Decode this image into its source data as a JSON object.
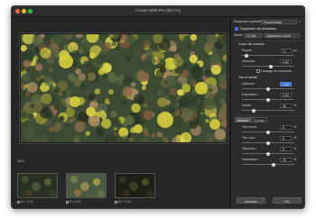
{
  "window": {
    "title": "Fusion HDR Pro (90,7%)"
  },
  "preview": {
    "zoom": "55%"
  },
  "thumbs": [
    {
      "label": "EV -3,00"
    },
    {
      "label": "EV 0,00"
    },
    {
      "label": "EV +3,00"
    }
  ],
  "panel": {
    "preset_label": "Paramètre prédéfini :",
    "preset_value": "Personnalisé",
    "remove_ghosts_label": "Supprimer les fantômes",
    "mode_label": "Mode :",
    "mode_value": "16 bits",
    "mode_value2": "Adaptation locale",
    "edge_section": "Lueur de contour",
    "radius_label": "Rayon :",
    "radius_value": "17",
    "radius_unit": "px",
    "strength_label": "Intensité :",
    "strength_value": "0,52",
    "smooth_edges_label": "Lissage de contours",
    "tone_section": "Ton et détail",
    "gamma_label": "Gamma :",
    "gamma_value": "1,00",
    "exposure_label": "Exposition :",
    "exposure_value": "0,00",
    "detail_label": "Détail :",
    "detail_value": "30",
    "detail_unit": "%",
    "tab_advanced": "Avancé",
    "tab_curve": "Courbe",
    "shadow_label": "Ton foncé :",
    "shadow_value": "0",
    "highlight_label": "Ton clair :",
    "highlight_value": "0",
    "vibrance_label": "Vibrance :",
    "vibrance_value": "0",
    "saturation_label": "Saturation :",
    "saturation_value": "20",
    "pct": "%",
    "cancel_label": "Annuler",
    "ok_label": "OK"
  }
}
